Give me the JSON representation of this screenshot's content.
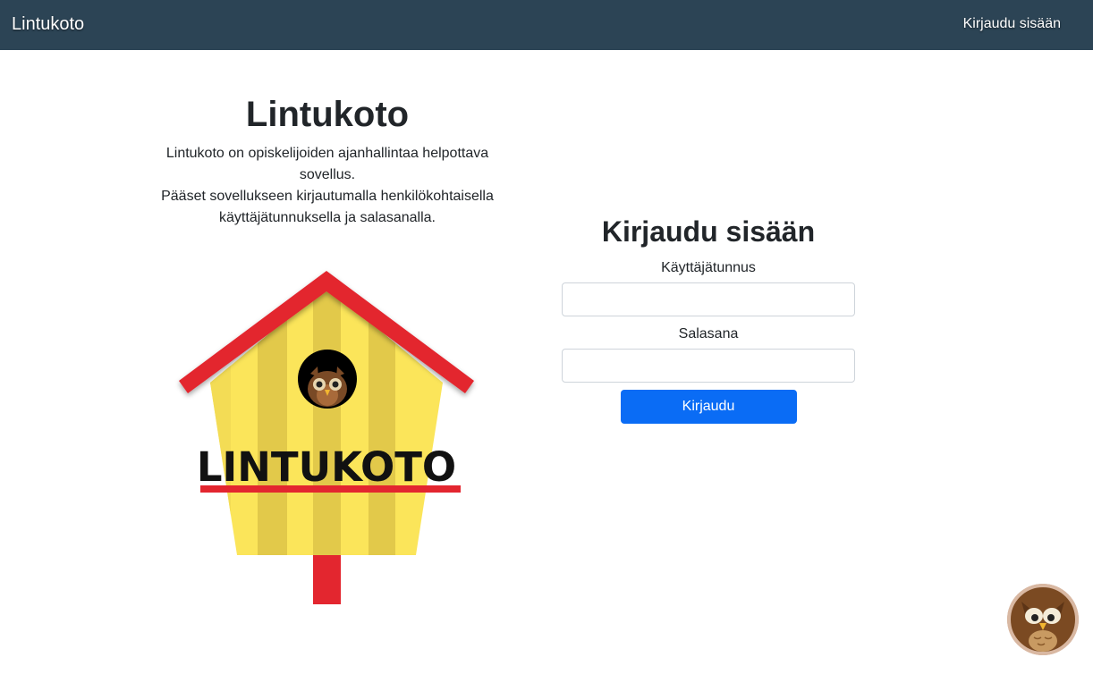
{
  "navbar": {
    "brand": "Lintukoto",
    "login_link": "Kirjaudu sisään"
  },
  "intro": {
    "title": "Lintukoto",
    "description_line1": "Lintukoto on opiskelijoiden ajanhallintaa helpottava sovellus.",
    "description_line2": "Pääset sovellukseen kirjautumalla henkilökohtaisella käyttäjätunnuksella ja salasanalla."
  },
  "logo": {
    "text": "LINTUKOTO"
  },
  "login_form": {
    "title": "Kirjaudu sisään",
    "username_label": "Käyttäjätunnus",
    "username_value": "",
    "password_label": "Salasana",
    "password_value": "",
    "submit_label": "Kirjaudu"
  },
  "colors": {
    "navbar": "#2c4455",
    "button": "#0a6cf5",
    "roof": "#e3262f",
    "house": "#fbe55a"
  },
  "icons": {
    "chat_avatar": "owl-icon",
    "logo_owl": "owl-icon"
  }
}
